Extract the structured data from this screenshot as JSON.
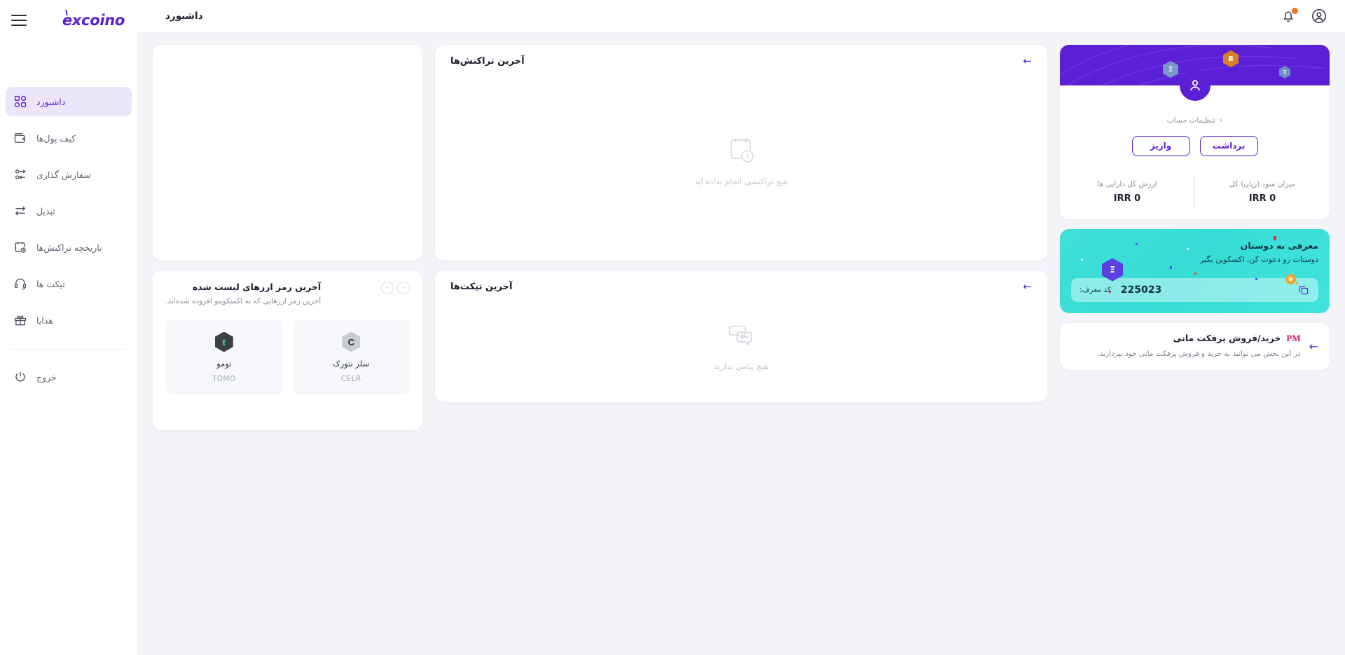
{
  "brand": {
    "name": "excoino",
    "logo_color": "#5b1fd6"
  },
  "sidebar": {
    "menu_icon": "hamburger-icon",
    "items": [
      {
        "label": "داشبورد",
        "icon": "grid-icon",
        "active": true
      },
      {
        "label": "کیف پول‌ها",
        "icon": "wallet-icon",
        "active": false
      },
      {
        "label": "سفارش گذاری",
        "icon": "orders-icon",
        "active": false
      },
      {
        "label": "تبدیل",
        "icon": "swap-icon",
        "active": false
      },
      {
        "label": "تاریخچه تراکنش‌ها",
        "icon": "history-icon",
        "active": false
      },
      {
        "label": "تیکت ها",
        "icon": "headset-icon",
        "active": false
      },
      {
        "label": "هدایا",
        "icon": "gift-icon",
        "active": false
      }
    ],
    "logout": {
      "label": "خروج",
      "icon": "power-icon"
    }
  },
  "topbar": {
    "title": "داشبورد",
    "profile_icon": "user-circle-icon",
    "bell_icon": "bell-icon",
    "bell_badge_color": "#f47521"
  },
  "profile_card": {
    "avatar_icon": "user-icon",
    "account_settings_label": "تنظیمات حساب",
    "chevron": "‹",
    "deposit_label": "واریز",
    "withdraw_label": "برداشت",
    "stats": [
      {
        "label": "ارزش کل دارایی ها",
        "value": "IRR 0"
      },
      {
        "label": "میزان سود (زیان) کل",
        "value": "IRR 0"
      }
    ],
    "banner_color": "#5b1fd6",
    "chips": [
      {
        "symbol": "Ƀ",
        "color": "#d98026"
      },
      {
        "symbol": "Ξ",
        "color": "#7a97c9"
      }
    ]
  },
  "referral_card": {
    "title": "معرفی به دوستان",
    "subtitle": "دوستات رو دعوت کن، اکسکوین بگیر",
    "code_label": "کد معرف:",
    "code_value": "225023",
    "copy_icon": "copy-icon",
    "bg_color": "#3fe0d8"
  },
  "pm_card": {
    "logo": "PM",
    "title": "خرید/فروش پرفکت مانی",
    "description": "در این بخش می توانید به خرید و فروش پرفکت مانی خود بپردازید.",
    "arrow": "←",
    "logo_color": "#d6146b"
  },
  "transactions_panel": {
    "title": "آخرین تراکنش‌ها",
    "arrow": "←",
    "empty_icon": "calendar-clock-icon",
    "empty_text": "هیچ تراکنشی انجام نداده اید"
  },
  "tickets_panel": {
    "title": "آخرین تیکت‌ها",
    "arrow": "←",
    "empty_icon": "chat-bubbles-icon",
    "empty_text": "هیچ پیامی ندارید"
  },
  "coins_panel": {
    "title": "آخرین رمز ارزهای لیست شده",
    "subtitle": "آخرین رمز ارزهایی که به اکسکوینو افزوده شده‌اند.",
    "prev_icon": "‹",
    "next_icon": "›",
    "coins": [
      {
        "name": "تومو",
        "symbol": "TOMO",
        "glyph": "t",
        "hex_color": "#3a4046",
        "glyph_color": "#39e6b0"
      },
      {
        "name": "سلر نتورک",
        "symbol": "CELR",
        "glyph": "C",
        "hex_color": "#c9ccd2",
        "glyph_color": "#1d2130"
      }
    ]
  }
}
